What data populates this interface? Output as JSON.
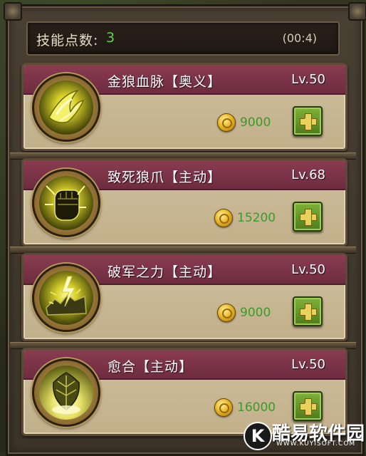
{
  "skill_points": {
    "label": "技能点数:",
    "value": "3",
    "timer": "(00:4)"
  },
  "skills": [
    {
      "name": "金狼血脉【奥义】",
      "level": "Lv.50",
      "cost": "9000",
      "icon": "golden-claw-swirl-icon"
    },
    {
      "name": "致死狼爪【主动】",
      "level": "Lv.68",
      "cost": "15200",
      "icon": "clenched-fist-icon"
    },
    {
      "name": "破军之力【主动】",
      "level": "Lv.50",
      "cost": "9000",
      "icon": "shattered-rock-lightning-icon"
    },
    {
      "name": "愈合【主动】",
      "level": "Lv.50",
      "cost": "16000",
      "icon": "glowing-leaf-icon"
    }
  ],
  "watermark": {
    "badge": "K",
    "text": "酷易软件园",
    "sub": "WWW.KUYISOFT.COM"
  },
  "colors": {
    "header": "#7a3448",
    "cost_text": "#3c9a2a",
    "points_value": "#5ed44e",
    "plus_button": "#6a9a2a"
  }
}
